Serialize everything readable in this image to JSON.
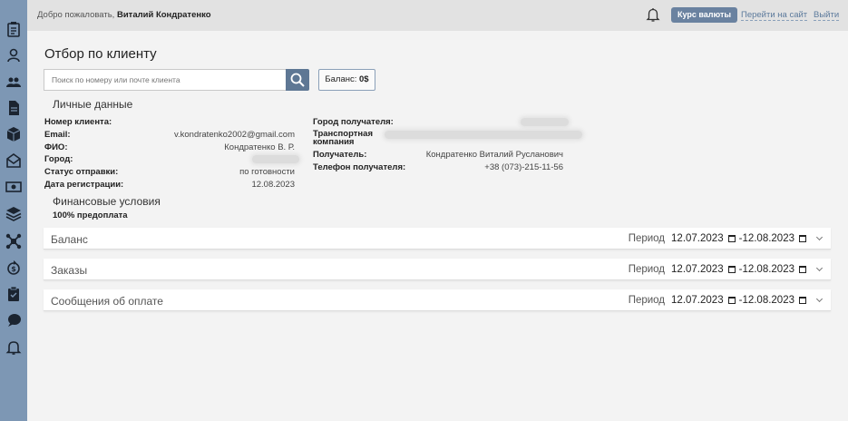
{
  "header": {
    "welcome_prefix": "Добро пожаловать, ",
    "user_name": "Виталий Кондратенко",
    "rates_button": "Курс валюты",
    "goto_site": "Перейти на сайт",
    "logout": "Выйти"
  },
  "sidebar": {
    "icons": [
      "clipboard-icon",
      "user-icon",
      "users-icon",
      "document-icon",
      "box-icon",
      "envelope-icon",
      "money-icon",
      "layers-icon",
      "drone-icon",
      "dollar-cycle-icon",
      "clipboard-check-icon",
      "chat-icon",
      "bell-icon"
    ]
  },
  "page": {
    "title": "Отбор по клиенту",
    "search_placeholder": "Поиск по номеру или почте клиента",
    "balance_label": "Баланс: ",
    "balance_value": "0$"
  },
  "personal": {
    "title": "Личные данные",
    "left": {
      "client_number_label": "Номер клиента:",
      "email_label": "Email:",
      "email_value": "v.kondratenko2002@gmail.com",
      "fio_label": "ФИО:",
      "fio_value": "Кондратенко В. Р.",
      "city_label": "Город:",
      "status_label": "Статус отправки:",
      "status_value": "по готовности",
      "reg_label": "Дата регистрации:",
      "reg_value": "12.08.2023"
    },
    "right": {
      "recipient_city_label": "Город получателя:",
      "transport_label_1": "Транспортная",
      "transport_label_2": "компания",
      "recipient_label": "Получатель:",
      "recipient_value": "Кондратенко Виталий Русланович",
      "phone_label": "Телефон получателя:",
      "phone_value": "+38 (073)-215-11-56"
    }
  },
  "finance": {
    "title": "Финансовые условия",
    "terms": "100% предоплата"
  },
  "panels": [
    {
      "title": "Баланс",
      "period_label": "Период",
      "date_from": "12.07.2023",
      "date_to": "12.08.2023"
    },
    {
      "title": "Заказы",
      "period_label": "Период",
      "date_from": "12.07.2023",
      "date_to": "12.08.2023"
    },
    {
      "title": "Сообщения об оплате",
      "period_label": "Период",
      "date_from": "12.07.2023",
      "date_to": "12.08.2023"
    }
  ]
}
